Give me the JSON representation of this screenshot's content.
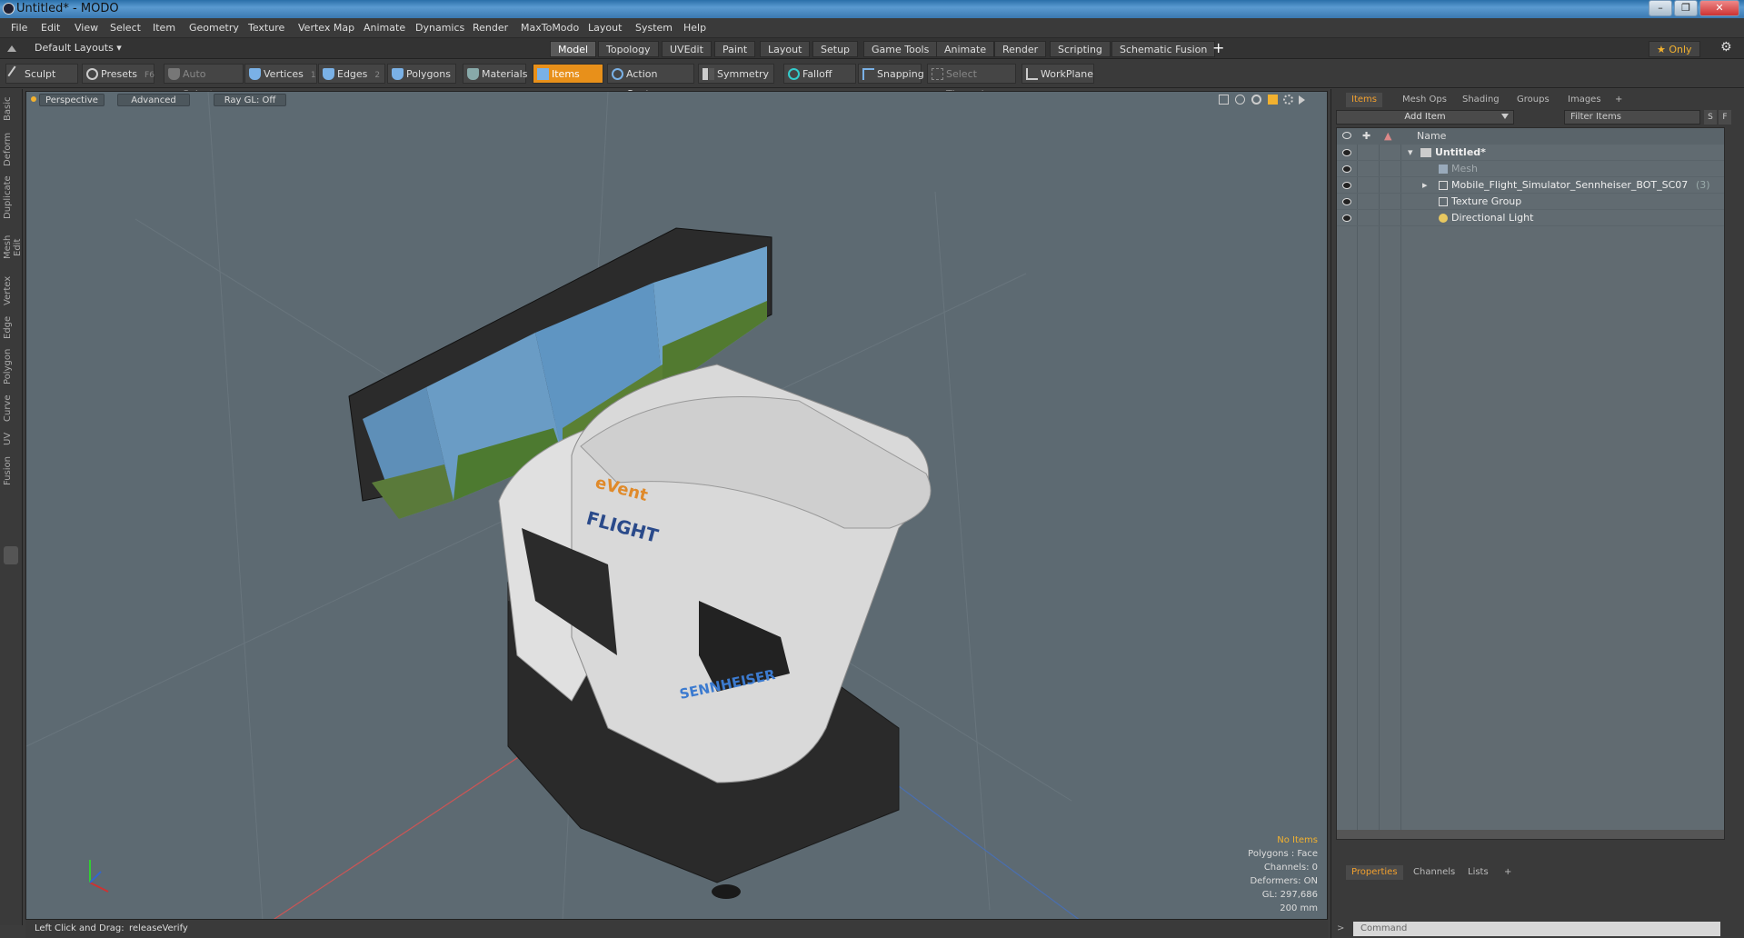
{
  "window": {
    "title": "Untitled* - MODO",
    "min": "–",
    "max": "❐",
    "close": "✕"
  },
  "menu": [
    "File",
    "Edit",
    "View",
    "Select",
    "Item",
    "Geometry",
    "Texture",
    "Vertex Map",
    "Animate",
    "Dynamics",
    "Render",
    "MaxToModo",
    "Layout",
    "System",
    "Help"
  ],
  "layout": {
    "selector": "Default Layouts ▾",
    "tabs": [
      "Model",
      "Topology",
      "UVEdit",
      "Paint",
      "Layout",
      "Setup",
      "Game Tools",
      "Animate",
      "Render",
      "Scripting",
      "Schematic Fusion"
    ],
    "active": "Model",
    "add": "+",
    "only": "★ Only",
    "settings": "⚙"
  },
  "toolbar": {
    "sculpt": "Sculpt",
    "presets": "Presets",
    "presets_key": "F6",
    "auto_select": "Auto Select",
    "vertices": "Vertices",
    "vertices_key": "1",
    "edges": "Edges",
    "edges_key": "2",
    "polygons": "Polygons",
    "materials": "Materials",
    "items": "Items",
    "action_center": "Action Center",
    "symmetry": "Symmetry",
    "falloff": "Falloff",
    "snapping": "Snapping",
    "select_through": "Select Through",
    "workplane": "WorkPlane"
  },
  "left_tabs": [
    "Basic",
    "Deform",
    "Duplicate",
    "Mesh Edit",
    "Vertex",
    "Edge",
    "Polygon",
    "Curve",
    "UV",
    "Fusion"
  ],
  "viewport": {
    "view": "Perspective",
    "advanced": "Advanced",
    "raygl": "Ray GL: Off",
    "info": {
      "no_items": "No Items",
      "polygons": "Polygons : Face",
      "channels": "Channels: 0",
      "deformers": "Deformers: ON",
      "gl": "GL: 297,686",
      "scale": "200 mm"
    },
    "colors": {
      "bg": "#5d6a72",
      "accent": "#f2b12f"
    }
  },
  "status": {
    "hint": "Left Click and Drag:",
    "action": "releaseVerify"
  },
  "right_panel": {
    "tabs": [
      "Items",
      "Mesh Ops",
      "Shading",
      "Groups",
      "Images",
      "+"
    ],
    "add_item": "Add Item",
    "filter": "Filter Items",
    "s_btn": "S",
    "f_btn": "F",
    "name_header": "Name",
    "tree": [
      {
        "label": "Untitled*",
        "indent": 0,
        "bold": true
      },
      {
        "label": "Mesh",
        "indent": 1,
        "dim": true
      },
      {
        "label": "Mobile_Flight_Simulator_Sennheiser_BOT_SC07",
        "count": "(3)",
        "indent": 1
      },
      {
        "label": "Texture Group",
        "indent": 1
      },
      {
        "label": "Directional Light",
        "indent": 1
      }
    ],
    "bottom_tabs": [
      "Properties",
      "Channels",
      "Lists",
      "+"
    ],
    "command_placeholder": "Command"
  },
  "model_text": {
    "brand1": "eVent",
    "brand2": "FLIGHT",
    "brand3": "SENNHEISER"
  }
}
